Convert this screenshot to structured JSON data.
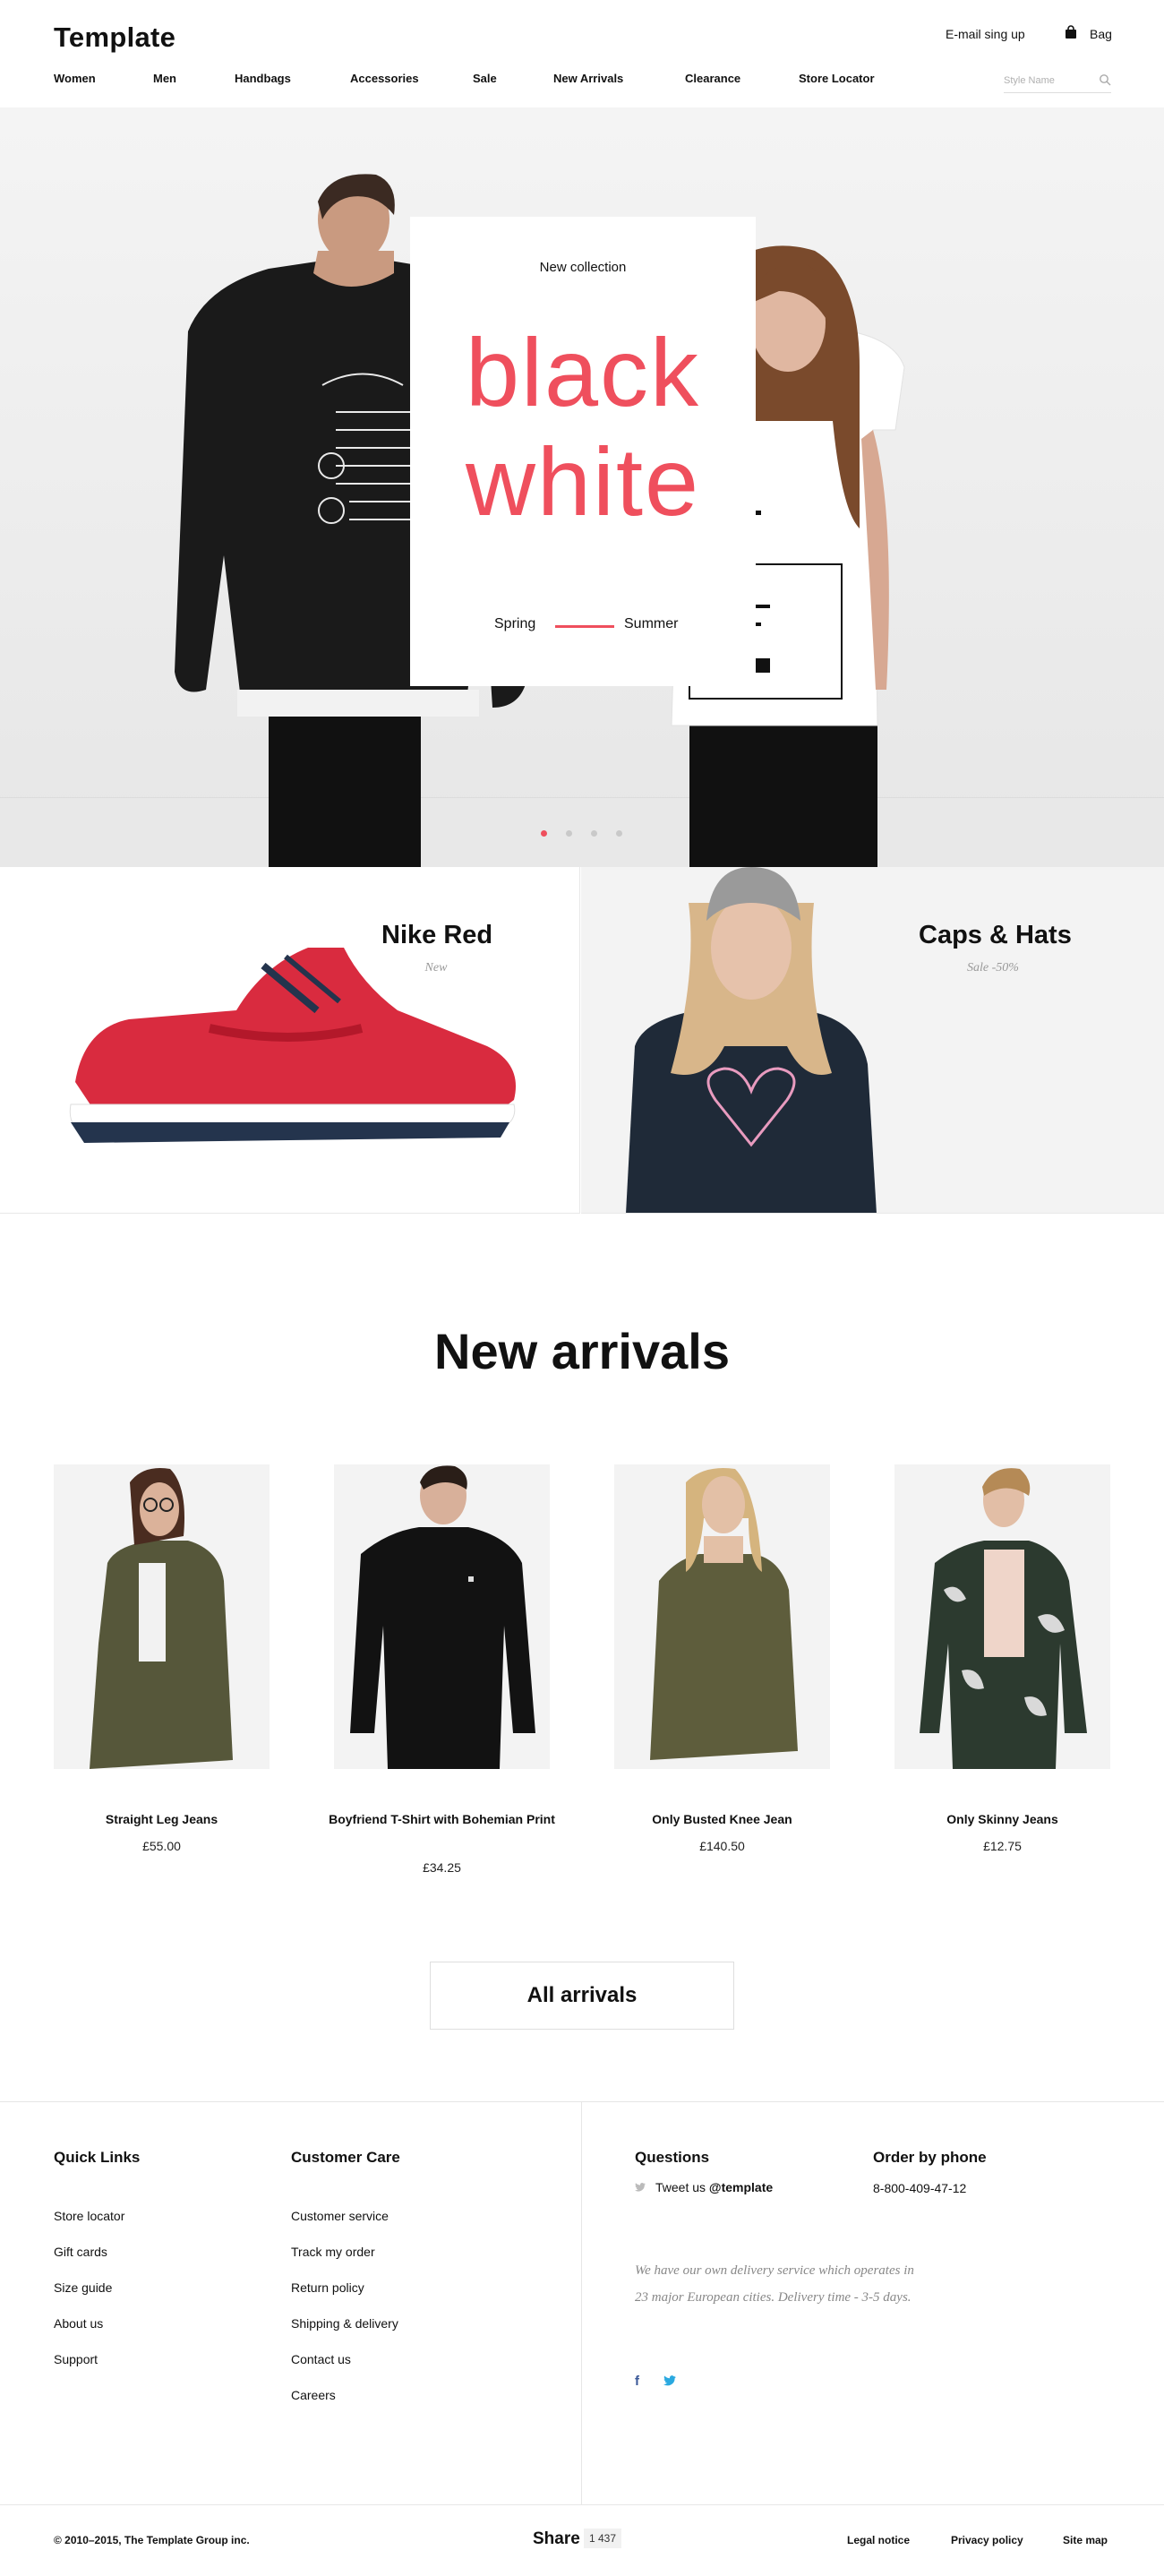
{
  "header": {
    "logo": "Template",
    "signup": "E-mail sing up",
    "bag": "Bag",
    "search_placeholder": "Style Name"
  },
  "nav": [
    "Women",
    "Men",
    "Handbags",
    "Accessories",
    "Sale",
    "New Arrivals",
    "Clearance",
    "Store Locator"
  ],
  "hero": {
    "kicker": "New collection",
    "line1": "black",
    "line2": "white",
    "season_left": "Spring",
    "season_right": "Summer",
    "accent": "#ef4f5d",
    "active_slide": 1,
    "slide_count": 4
  },
  "promos": [
    {
      "title": "Nike Red",
      "subtitle": "New"
    },
    {
      "title": "Caps & Hats",
      "subtitle": "Sale -50%"
    }
  ],
  "arrivals": {
    "title": "New arrivals",
    "products": [
      {
        "name": "Straight Leg Jeans",
        "price": "£55.00"
      },
      {
        "name": "Boyfriend T-Shirt with Bohemian Print",
        "price": "£34.25"
      },
      {
        "name": "Only Busted Knee Jean",
        "price": "£140.50"
      },
      {
        "name": "Only Skinny Jeans",
        "price": "£12.75"
      }
    ],
    "all_button": "All arrivals"
  },
  "footer": {
    "quick_links": {
      "title": "Quick Links",
      "items": [
        "Store locator",
        "Gift cards",
        "Size guide",
        "About us",
        "Support"
      ]
    },
    "customer_care": {
      "title": "Customer Care",
      "items": [
        "Customer service",
        "Track my order",
        "Return policy",
        "Shipping & delivery",
        "Contact us",
        "Careers"
      ]
    },
    "questions": {
      "title": "Questions",
      "tweet_prefix": "Tweet us",
      "handle": "@template",
      "delivery": "We have our own delivery service which operates in 23 major European cities. Delivery time - 3-5 days."
    },
    "order_phone": {
      "title": "Order by phone",
      "number": "8-800-409-47-12"
    },
    "copyright": "© 2010–2015, The Template Group inc.",
    "share_label": "Share",
    "share_count": "1 437",
    "bottom_links": [
      "Legal notice",
      "Privacy policy",
      "Site map"
    ]
  }
}
